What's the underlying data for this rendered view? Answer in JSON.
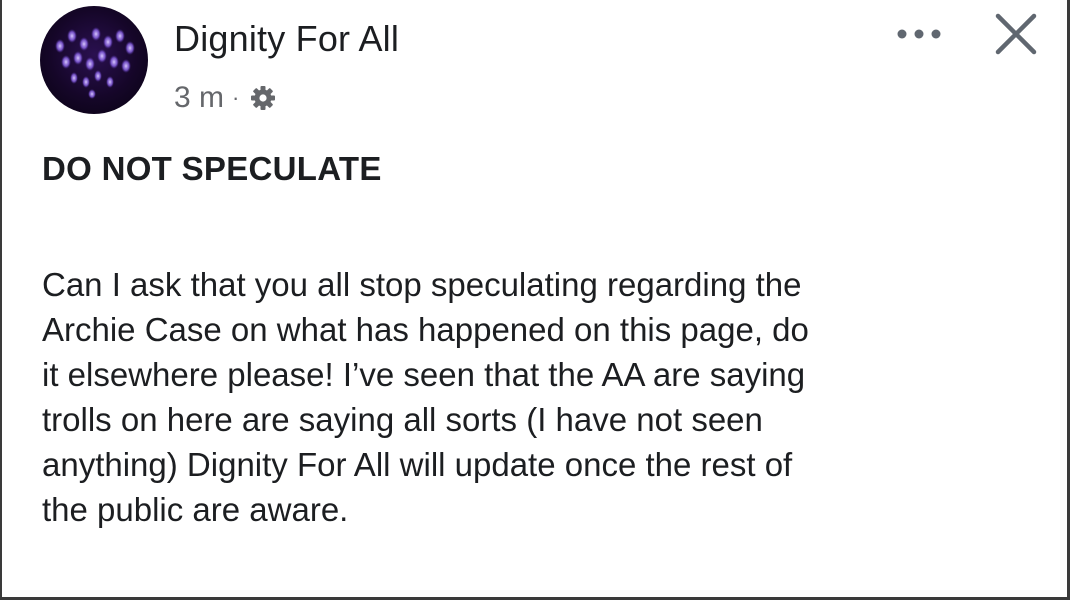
{
  "post": {
    "page_name": "Dignity For All",
    "timestamp": "3 m",
    "separator": "·",
    "audience_icon": "gear-icon",
    "more_icon": "more-icon",
    "close_icon": "close-icon",
    "title": "DO NOT SPECULATE",
    "body_lines": [
      "Can I ask that you all stop speculating regarding the",
      "Archie Case on what has happened on this page, do",
      "it elsewhere please! I’ve seen that the AA are saying",
      "trolls on here are saying all sorts (I have not seen",
      "anything) Dignity For All will update once the rest of",
      "the public are aware."
    ]
  },
  "colors": {
    "text": "#1c1e21",
    "meta_text": "#65676b",
    "frame_border": "#3a3a3a",
    "avatar_bg": "#150628",
    "avatar_lights": "#a98cf0"
  }
}
